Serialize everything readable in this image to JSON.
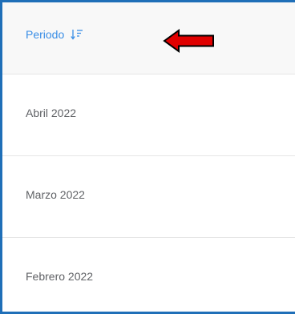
{
  "table": {
    "header": {
      "label": "Periodo",
      "sort_icon": "sort-descending-icon"
    },
    "rows": [
      {
        "period": "Abril 2022"
      },
      {
        "period": "Marzo 2022"
      },
      {
        "period": "Febrero 2022"
      }
    ]
  },
  "annotation": {
    "icon": "left-arrow-icon",
    "color": "#e00000"
  },
  "colors": {
    "frame_border": "#1f6fb8",
    "header_text": "#3a8ee6",
    "body_text": "#606266",
    "row_divider": "#e6e6e6"
  }
}
